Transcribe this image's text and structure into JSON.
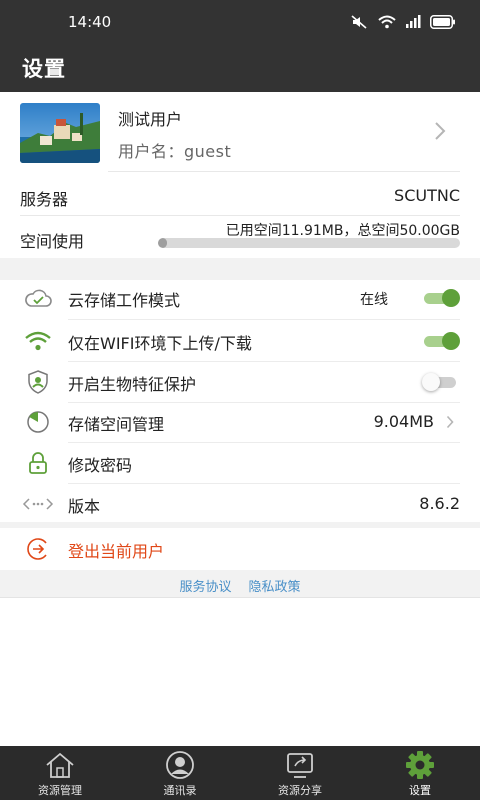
{
  "status_bar": {
    "time": "14:40",
    "icons": [
      "mute-icon",
      "wifi-icon",
      "signal-icon",
      "battery-icon"
    ]
  },
  "header": {
    "title": "设置"
  },
  "profile": {
    "name": "测试用户",
    "account": "用户名：guest",
    "avatar": "avatar-photo"
  },
  "server": {
    "label": "服务器",
    "value": "SCUTNC"
  },
  "storage": {
    "label": "空间使用",
    "summary": "已用空间11.91MB，总空间50.00GB",
    "used_fraction": 0.0002
  },
  "settings": {
    "cloud_mode": {
      "label": "云存储工作模式",
      "status": "在线",
      "enabled": true,
      "icon": "cloud-icon"
    },
    "wifi_only": {
      "label": "仅在WIFI环境下上传/下载",
      "enabled": true,
      "icon": "wifi-icon"
    },
    "biometric": {
      "label": "开启生物特征保护",
      "enabled": false,
      "icon": "shield-user-icon"
    },
    "storage_mgmt": {
      "label": "存储空间管理",
      "value": "9.04MB",
      "icon": "pie-chart-icon"
    },
    "change_password": {
      "label": "修改密码",
      "icon": "lock-icon"
    },
    "version": {
      "label": "版本",
      "value": "8.6.2",
      "icon": "code-icon"
    }
  },
  "logout": {
    "label": "登出当前用户",
    "icon": "logout-icon"
  },
  "links": {
    "terms": "服务协议",
    "privacy": "隐私政策"
  },
  "tabs": [
    {
      "label": "资源管理",
      "icon": "home-icon",
      "active": false
    },
    {
      "label": "通讯录",
      "icon": "contact-icon",
      "active": false
    },
    {
      "label": "资源分享",
      "icon": "share-icon",
      "active": false
    },
    {
      "label": "设置",
      "icon": "gear-icon",
      "active": true
    }
  ],
  "colors": {
    "header_bg": "#333333",
    "accent_green": "#5ea03a",
    "toggle_track_on": "#a8d08d",
    "logout_red": "#e04818",
    "link_blue": "#4a90c8",
    "tab_bar_bg": "#2b2b2b"
  }
}
